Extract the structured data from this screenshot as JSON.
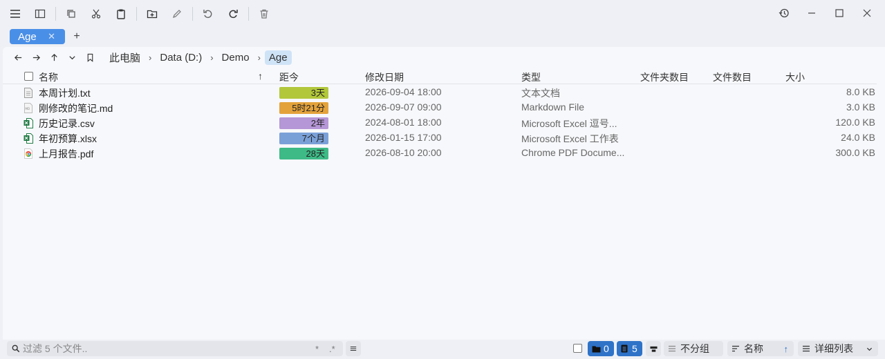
{
  "toolbar": {
    "buttons": [
      "menu-icon",
      "panel-icon",
      "copy-icon",
      "cut-icon",
      "paste-icon",
      "new-folder-icon",
      "rename-icon",
      "undo-icon",
      "redo-icon",
      "delete-icon"
    ],
    "window": [
      "history-icon",
      "minimize-icon",
      "maximize-icon",
      "close-icon"
    ]
  },
  "tabs": [
    {
      "label": "Age",
      "close": "✕"
    }
  ],
  "tab_add": "+",
  "breadcrumb": {
    "items": [
      "此电脑",
      "Data (D:)",
      "Demo",
      "Age"
    ],
    "separator": "›"
  },
  "columns": {
    "name": "名称",
    "age": "距今",
    "date": "修改日期",
    "type": "类型",
    "folder_count": "文件夹数目",
    "file_count": "文件数目",
    "size": "大小"
  },
  "sort_arrow": "↑",
  "files": [
    {
      "name": "本周计划.txt",
      "age": "3天",
      "age_color": "#b2c73a",
      "date": "2026-09-04 18:00",
      "type": "文本文档",
      "size": "8.0 KB",
      "icon": "text-file-icon"
    },
    {
      "name": "刚修改的笔记.md",
      "age": "5时21分",
      "age_color": "#e3a23a",
      "date": "2026-09-07 09:00",
      "type": "Markdown File",
      "size": "3.0 KB",
      "icon": "markdown-file-icon"
    },
    {
      "name": "历史记录.csv",
      "age": "2年",
      "age_color": "#b596d6",
      "date": "2024-08-01 18:00",
      "type": "Microsoft Excel 逗号...",
      "size": "120.0 KB",
      "icon": "excel-file-icon"
    },
    {
      "name": "年初预算.xlsx",
      "age": "7个月",
      "age_color": "#7aa0d8",
      "date": "2026-01-15 17:00",
      "type": "Microsoft Excel 工作表",
      "size": "24.0 KB",
      "icon": "excel-file-icon"
    },
    {
      "name": "上月报告.pdf",
      "age": "28天",
      "age_color": "#3dba86",
      "date": "2026-08-10 20:00",
      "type": "Chrome PDF Docume...",
      "size": "300.0 KB",
      "icon": "chrome-pdf-icon"
    }
  ],
  "status": {
    "filter_placeholder": "过滤 5 个文件..",
    "filter_opt1": "*",
    "filter_opt2": ".*",
    "folders_count": "0",
    "files_count": "5",
    "group": "不分组",
    "sort": "名称",
    "sort_dir": "↑",
    "view": "详细列表"
  },
  "colors": {
    "accent": "#4a8fe7",
    "status_blue": "#2f73c8"
  }
}
